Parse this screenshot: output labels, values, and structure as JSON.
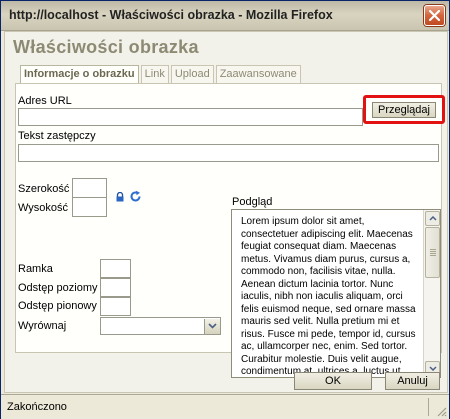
{
  "window": {
    "title": "http://localhost - Właściwości obrazka - Mozilla Firefox"
  },
  "dialog": {
    "title": "Właściwości obrazka",
    "tabs": [
      {
        "label": "Informacje o obrazku",
        "active": true
      },
      {
        "label": "Link",
        "active": false
      },
      {
        "label": "Upload",
        "active": false
      },
      {
        "label": "Zaawansowane",
        "active": false
      }
    ],
    "fields": {
      "url_label": "Adres URL",
      "url_value": "",
      "browse_label": "Przeglądaj",
      "alt_label": "Tekst zastępczy",
      "alt_value": "",
      "width_label": "Szerokość",
      "width_value": "",
      "height_label": "Wysokość",
      "height_value": "",
      "border_label": "Ramka",
      "border_value": "",
      "hspace_label": "Odstęp poziomy",
      "hspace_value": "",
      "vspace_label": "Odstęp pionowy",
      "vspace_value": "",
      "align_label": "Wyrównaj",
      "align_value": ""
    },
    "preview": {
      "label": "Podgląd",
      "text": "Lorem ipsum dolor sit amet, consectetuer adipiscing elit. Maecenas feugiat consequat diam. Maecenas metus. Vivamus diam purus, cursus a, commodo non, facilisis vitae, nulla. Aenean dictum lacinia tortor. Nunc iaculis, nibh non iaculis aliquam, orci felis euismod neque, sed ornare massa mauris sed velit. Nulla pretium mi et risus. Fusce mi pede, tempor id, cursus ac, ullamcorper nec, enim. Sed tortor. Curabitur molestie. Duis velit augue, condimentum at, ultrices a, luctus ut, orci."
    },
    "buttons": {
      "ok": "OK",
      "cancel": "Anuluj"
    }
  },
  "status": {
    "text": "Zakończono"
  },
  "colors": {
    "highlight": "#e31212",
    "dialog_title": "#8d8a74"
  }
}
